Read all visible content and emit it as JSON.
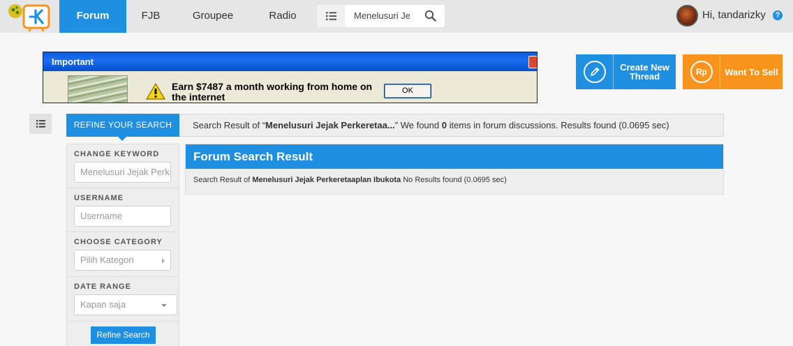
{
  "nav": {
    "tabs": [
      {
        "label": "Forum",
        "active": true
      },
      {
        "label": "FJB",
        "active": false
      },
      {
        "label": "Groupee",
        "active": false
      },
      {
        "label": "Radio",
        "active": false
      }
    ],
    "search_value": "Menelusuri Je",
    "user_greeting": "Hi, tandarizky",
    "help_label": "?"
  },
  "ad": {
    "title": "Important",
    "message": "Earn $7487 a month working from home on the internet",
    "ok_label": "OK"
  },
  "actions": {
    "create_thread": "Create New Thread",
    "want_to_sell": "Want To Sell",
    "sell_icon_text": "Rp"
  },
  "result_bar": {
    "refine_tab": "REFINE YOUR SEARCH",
    "prefix": "Search Result of “",
    "query": "Menelusuri Jejak Perkeretaa...",
    "middle": "” We found ",
    "count": "0",
    "suffix": " items in forum discussions. Results found (0.0695 sec)"
  },
  "sidebar": {
    "keyword_label": "CHANGE KEYWORD",
    "keyword_value": "Menelusuri Jejak Perkeretaaplan Ibukota",
    "username_label": "USERNAME",
    "username_placeholder": "Username",
    "category_label": "CHOOSE CATEGORY",
    "category_value": "Pilih Kategori",
    "date_label": "DATE RANGE",
    "date_value": "Kapan saja",
    "refine_button": "Refine Search"
  },
  "panel": {
    "title": "Forum Search Result",
    "prefix": "Search Result of ",
    "query": "Menelusuri Jejak Perkeretaaplan Ibukota",
    "suffix": " No Results found (0.0695 sec)"
  },
  "colors": {
    "primary": "#1e8fe1",
    "sell": "#f8941d",
    "nav_bg": "#e6e6e6"
  }
}
